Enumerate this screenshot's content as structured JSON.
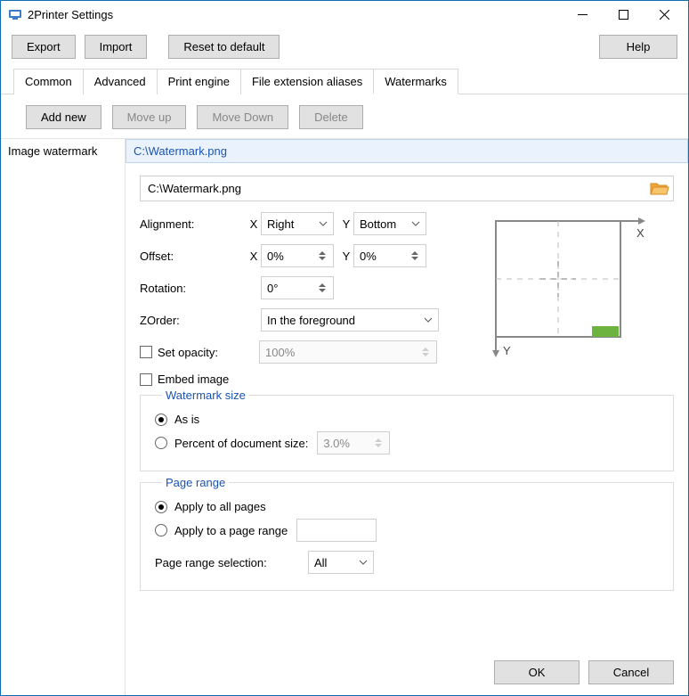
{
  "window": {
    "title": "2Printer Settings"
  },
  "toolbar": {
    "export": "Export",
    "import": "Import",
    "reset": "Reset to default",
    "help": "Help"
  },
  "tabs": [
    "Common",
    "Advanced",
    "Print engine",
    "File extension aliases",
    "Watermarks"
  ],
  "active_tab": 4,
  "wm_toolbar": {
    "add": "Add new",
    "up": "Move up",
    "down": "Move Down",
    "delete": "Delete"
  },
  "sidebar": {
    "items": [
      "Image watermark"
    ]
  },
  "header_path": "C:\\Watermark.png",
  "form": {
    "path": "C:\\Watermark.png",
    "alignment_label": "Alignment:",
    "x_label": "X",
    "y_label": "Y",
    "align_x": "Right",
    "align_y": "Bottom",
    "offset_label": "Offset:",
    "offset_x": "0%",
    "offset_y": "0%",
    "rotation_label": "Rotation:",
    "rotation": "0°",
    "zorder_label": "ZOrder:",
    "zorder": "In the foreground",
    "opacity_label": "Set opacity:",
    "opacity": "100%",
    "embed_label": "Embed image"
  },
  "size_group": {
    "legend": "Watermark size",
    "as_is": "As is",
    "percent_label": "Percent of document size:",
    "percent": "3.0%"
  },
  "range_group": {
    "legend": "Page range",
    "all": "Apply to all pages",
    "range": "Apply to a page range",
    "range_value": "",
    "selection_label": "Page range selection:",
    "selection": "All"
  },
  "preview": {
    "x_axis": "X",
    "y_axis": "Y"
  },
  "footer": {
    "ok": "OK",
    "cancel": "Cancel"
  }
}
